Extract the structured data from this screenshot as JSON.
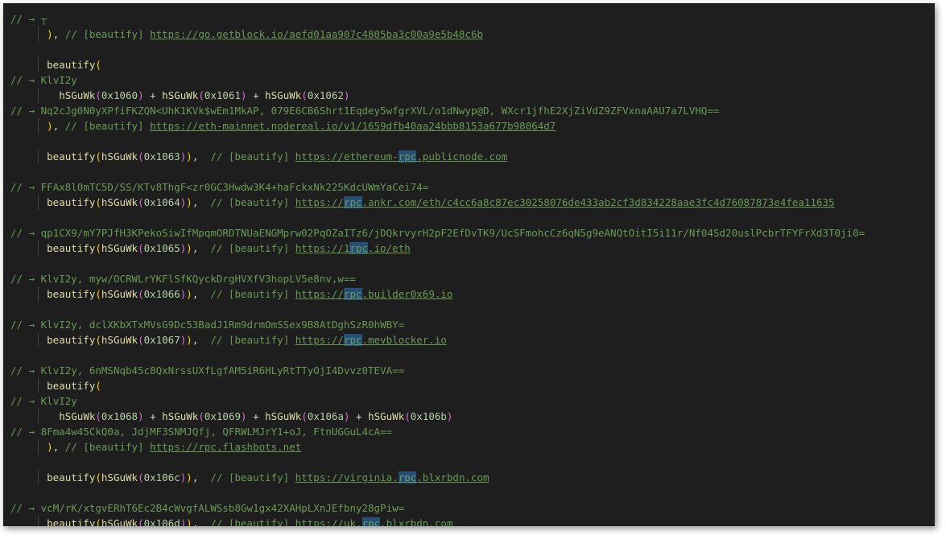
{
  "editor": {
    "comment_prefix": "// → ",
    "tag": "// [beautify] ",
    "fn": "beautify",
    "hfn": "hSGuWk",
    "highlight_word": "rpc",
    "lines": [
      {
        "k": "cmt",
        "ind": 0,
        "text": "┬"
      },
      {
        "k": "close",
        "ind": 1,
        "url": "https://go.getblock.io/aefd01aa907c4805ba3c00a9e5b48c6b"
      },
      {
        "k": "blank"
      },
      {
        "k": "open",
        "ind": 1
      },
      {
        "k": "cmt",
        "ind": 0,
        "text": "KlvI2y"
      },
      {
        "k": "sum",
        "ind": 2,
        "args": [
          "0x1060",
          "0x1061",
          "0x1062"
        ]
      },
      {
        "k": "cmt",
        "ind": 0,
        "text": "Nq2cJg0N0yXPfiFKZQN<UhK1KVk$wEm1MkAP, 079E6CB6Shrt1Eqdey5wfgrXVL/o1dNwyp@D, WXcr1jfhE2XjZiVdZ9ZFVxnaAAU7a7LVHQ=="
      },
      {
        "k": "close",
        "ind": 1,
        "url": "https://eth-mainnet.nodereal.io/v1/1659dfb40aa24bbb8153a677b98064d7"
      },
      {
        "k": "blank"
      },
      {
        "k": "call",
        "ind": 1,
        "arg": "0x1063",
        "url": "https://ethereum-rpc.publicnode.com"
      },
      {
        "k": "blank"
      },
      {
        "k": "cmt",
        "ind": 0,
        "text": "FFAx8l0mTC5D/SS/KTv8ThgF<zr0GC3Hwdw3K4+haFckxNk225KdcUWmYaCei74="
      },
      {
        "k": "call",
        "ind": 1,
        "arg": "0x1064",
        "url": "https://rpc.ankr.com/eth/c4cc6a8c87ec30258076de433ab2cf3d834228aae3fc4d76087873e4fea11635"
      },
      {
        "k": "blank"
      },
      {
        "k": "cmt",
        "ind": 0,
        "text": "qp1CX9/mY7PJfH3KPekoSiwIfMpqmORDTNUaENGMprw02PqOZaITz6/jDQkrvyrH2pF2EfDvTK9/UcSFmohcCz6qN5g9eANQtOitI5i11r/Nf04Sd20uslPcbrTFYFrXd3T0ji0="
      },
      {
        "k": "call",
        "ind": 1,
        "arg": "0x1065",
        "url": "https://1rpc.io/eth"
      },
      {
        "k": "blank"
      },
      {
        "k": "cmt",
        "ind": 0,
        "text": "KlvI2y, myw/OCRWLrYKFlSfKQyckDrgHVXfV3hopLV5e8nv,w=="
      },
      {
        "k": "call",
        "ind": 1,
        "arg": "0x1066",
        "url": "https://rpc.builder0x69.io"
      },
      {
        "k": "blank"
      },
      {
        "k": "cmt",
        "ind": 0,
        "text": "KlvI2y, dclXKbXTxMVsG9Dc53BadJ1Rm9drmOmSSex9B8AtDghSzR0hWBY="
      },
      {
        "k": "call",
        "ind": 1,
        "arg": "0x1067",
        "url": "https://rpc.mevblocker.io"
      },
      {
        "k": "blank"
      },
      {
        "k": "cmt",
        "ind": 0,
        "text": "KlvI2y, 6nMSNqb45c8QxNrssUXfLgfAM5iR6HLyRtTTyOjI4Dvvz0TEVA=="
      },
      {
        "k": "open",
        "ind": 1
      },
      {
        "k": "cmt",
        "ind": 0,
        "text": "KlvI2y"
      },
      {
        "k": "sum",
        "ind": 2,
        "args": [
          "0x1068",
          "0x1069",
          "0x106a",
          "0x106b"
        ]
      },
      {
        "k": "cmt",
        "ind": 0,
        "text": "8Fma4w45CkQ0a, JdjMF3SNMJQfj, QFRWLMJrY1+oJ, FtnUGGuL4cA=="
      },
      {
        "k": "close",
        "ind": 1,
        "url": "https://rpc.flashbots.net"
      },
      {
        "k": "blank"
      },
      {
        "k": "call",
        "ind": 1,
        "arg": "0x106c",
        "url": "https://virginia.rpc.blxrbdn.com"
      },
      {
        "k": "blank"
      },
      {
        "k": "cmt",
        "ind": 0,
        "text": "vcM/rK/xtgvERhT6Ec2B4cWvgfALWSsb8Gw1gx42XAHpLXnJEfbny28gPiw="
      },
      {
        "k": "call",
        "ind": 1,
        "arg": "0x106d",
        "url": "https://uk.rpc.blxrbdn.com"
      }
    ]
  }
}
